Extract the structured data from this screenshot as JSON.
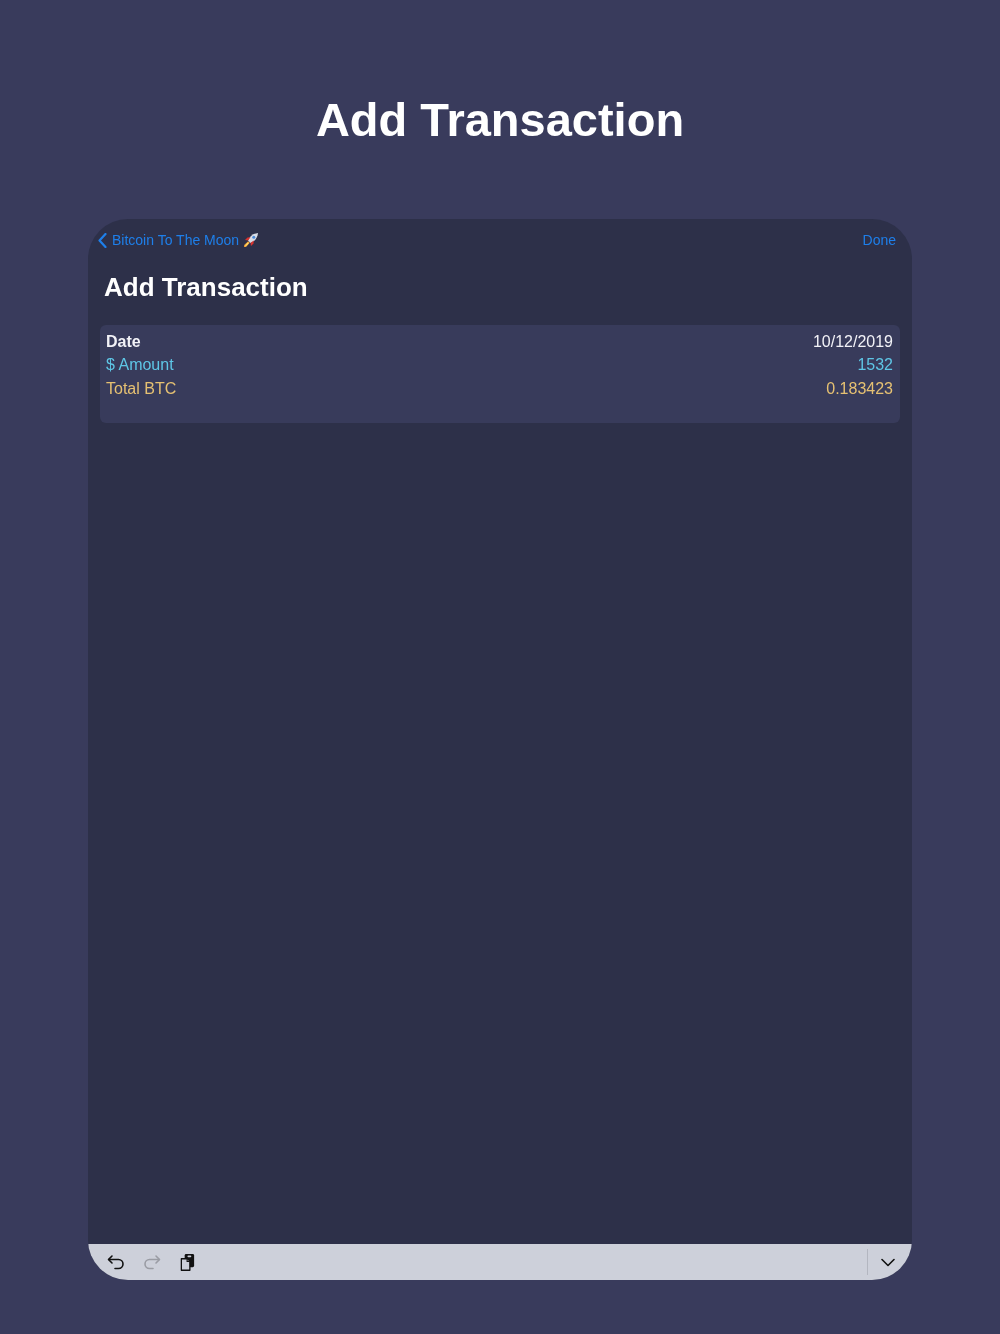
{
  "page_title": "Add Transaction",
  "nav_bar": {
    "back_label": "Bitcoin To The Moon",
    "done": "Done",
    "title": "Add Transaction"
  },
  "fields": [
    {
      "label": "Date",
      "value": "10/12/2019",
      "color": "#f2f2f7"
    },
    {
      "label": "$ Amount",
      "value": "1532",
      "color": "#5ec6e6"
    },
    {
      "label": "Total BTC",
      "value": "0.183423",
      "color": "#e6c172"
    }
  ],
  "keyboard_toolbar": {
    "buttons": [
      {
        "kind": "undo",
        "disabled": false
      },
      {
        "kind": "redo",
        "disabled": true
      },
      {
        "kind": "paste",
        "disabled": false
      }
    ]
  }
}
